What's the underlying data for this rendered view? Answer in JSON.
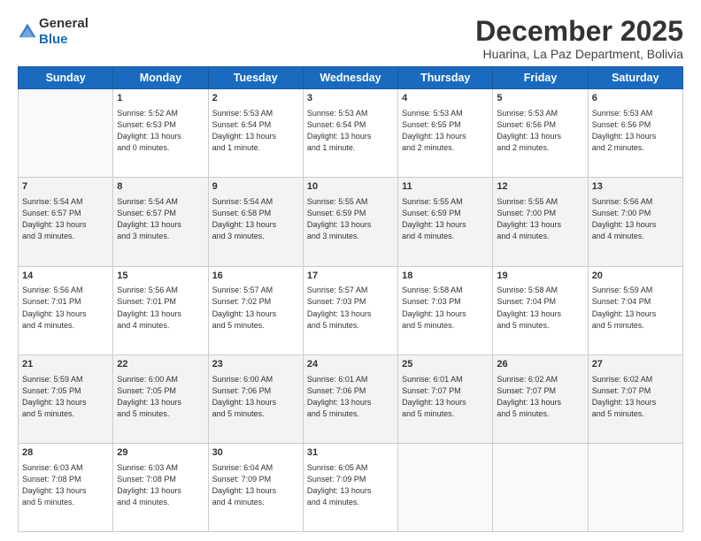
{
  "header": {
    "logo_general": "General",
    "logo_blue": "Blue",
    "month_title": "December 2025",
    "location": "Huarina, La Paz Department, Bolivia"
  },
  "days_of_week": [
    "Sunday",
    "Monday",
    "Tuesday",
    "Wednesday",
    "Thursday",
    "Friday",
    "Saturday"
  ],
  "weeks": [
    {
      "days": [
        {
          "num": "",
          "info": ""
        },
        {
          "num": "1",
          "info": "Sunrise: 5:52 AM\nSunset: 6:53 PM\nDaylight: 13 hours\nand 0 minutes."
        },
        {
          "num": "2",
          "info": "Sunrise: 5:53 AM\nSunset: 6:54 PM\nDaylight: 13 hours\nand 1 minute."
        },
        {
          "num": "3",
          "info": "Sunrise: 5:53 AM\nSunset: 6:54 PM\nDaylight: 13 hours\nand 1 minute."
        },
        {
          "num": "4",
          "info": "Sunrise: 5:53 AM\nSunset: 6:55 PM\nDaylight: 13 hours\nand 2 minutes."
        },
        {
          "num": "5",
          "info": "Sunrise: 5:53 AM\nSunset: 6:56 PM\nDaylight: 13 hours\nand 2 minutes."
        },
        {
          "num": "6",
          "info": "Sunrise: 5:53 AM\nSunset: 6:56 PM\nDaylight: 13 hours\nand 2 minutes."
        }
      ]
    },
    {
      "days": [
        {
          "num": "7",
          "info": "Sunrise: 5:54 AM\nSunset: 6:57 PM\nDaylight: 13 hours\nand 3 minutes."
        },
        {
          "num": "8",
          "info": "Sunrise: 5:54 AM\nSunset: 6:57 PM\nDaylight: 13 hours\nand 3 minutes."
        },
        {
          "num": "9",
          "info": "Sunrise: 5:54 AM\nSunset: 6:58 PM\nDaylight: 13 hours\nand 3 minutes."
        },
        {
          "num": "10",
          "info": "Sunrise: 5:55 AM\nSunset: 6:59 PM\nDaylight: 13 hours\nand 3 minutes."
        },
        {
          "num": "11",
          "info": "Sunrise: 5:55 AM\nSunset: 6:59 PM\nDaylight: 13 hours\nand 4 minutes."
        },
        {
          "num": "12",
          "info": "Sunrise: 5:55 AM\nSunset: 7:00 PM\nDaylight: 13 hours\nand 4 minutes."
        },
        {
          "num": "13",
          "info": "Sunrise: 5:56 AM\nSunset: 7:00 PM\nDaylight: 13 hours\nand 4 minutes."
        }
      ]
    },
    {
      "days": [
        {
          "num": "14",
          "info": "Sunrise: 5:56 AM\nSunset: 7:01 PM\nDaylight: 13 hours\nand 4 minutes."
        },
        {
          "num": "15",
          "info": "Sunrise: 5:56 AM\nSunset: 7:01 PM\nDaylight: 13 hours\nand 4 minutes."
        },
        {
          "num": "16",
          "info": "Sunrise: 5:57 AM\nSunset: 7:02 PM\nDaylight: 13 hours\nand 5 minutes."
        },
        {
          "num": "17",
          "info": "Sunrise: 5:57 AM\nSunset: 7:03 PM\nDaylight: 13 hours\nand 5 minutes."
        },
        {
          "num": "18",
          "info": "Sunrise: 5:58 AM\nSunset: 7:03 PM\nDaylight: 13 hours\nand 5 minutes."
        },
        {
          "num": "19",
          "info": "Sunrise: 5:58 AM\nSunset: 7:04 PM\nDaylight: 13 hours\nand 5 minutes."
        },
        {
          "num": "20",
          "info": "Sunrise: 5:59 AM\nSunset: 7:04 PM\nDaylight: 13 hours\nand 5 minutes."
        }
      ]
    },
    {
      "days": [
        {
          "num": "21",
          "info": "Sunrise: 5:59 AM\nSunset: 7:05 PM\nDaylight: 13 hours\nand 5 minutes."
        },
        {
          "num": "22",
          "info": "Sunrise: 6:00 AM\nSunset: 7:05 PM\nDaylight: 13 hours\nand 5 minutes."
        },
        {
          "num": "23",
          "info": "Sunrise: 6:00 AM\nSunset: 7:06 PM\nDaylight: 13 hours\nand 5 minutes."
        },
        {
          "num": "24",
          "info": "Sunrise: 6:01 AM\nSunset: 7:06 PM\nDaylight: 13 hours\nand 5 minutes."
        },
        {
          "num": "25",
          "info": "Sunrise: 6:01 AM\nSunset: 7:07 PM\nDaylight: 13 hours\nand 5 minutes."
        },
        {
          "num": "26",
          "info": "Sunrise: 6:02 AM\nSunset: 7:07 PM\nDaylight: 13 hours\nand 5 minutes."
        },
        {
          "num": "27",
          "info": "Sunrise: 6:02 AM\nSunset: 7:07 PM\nDaylight: 13 hours\nand 5 minutes."
        }
      ]
    },
    {
      "days": [
        {
          "num": "28",
          "info": "Sunrise: 6:03 AM\nSunset: 7:08 PM\nDaylight: 13 hours\nand 5 minutes."
        },
        {
          "num": "29",
          "info": "Sunrise: 6:03 AM\nSunset: 7:08 PM\nDaylight: 13 hours\nand 4 minutes."
        },
        {
          "num": "30",
          "info": "Sunrise: 6:04 AM\nSunset: 7:09 PM\nDaylight: 13 hours\nand 4 minutes."
        },
        {
          "num": "31",
          "info": "Sunrise: 6:05 AM\nSunset: 7:09 PM\nDaylight: 13 hours\nand 4 minutes."
        },
        {
          "num": "",
          "info": ""
        },
        {
          "num": "",
          "info": ""
        },
        {
          "num": "",
          "info": ""
        }
      ]
    }
  ]
}
